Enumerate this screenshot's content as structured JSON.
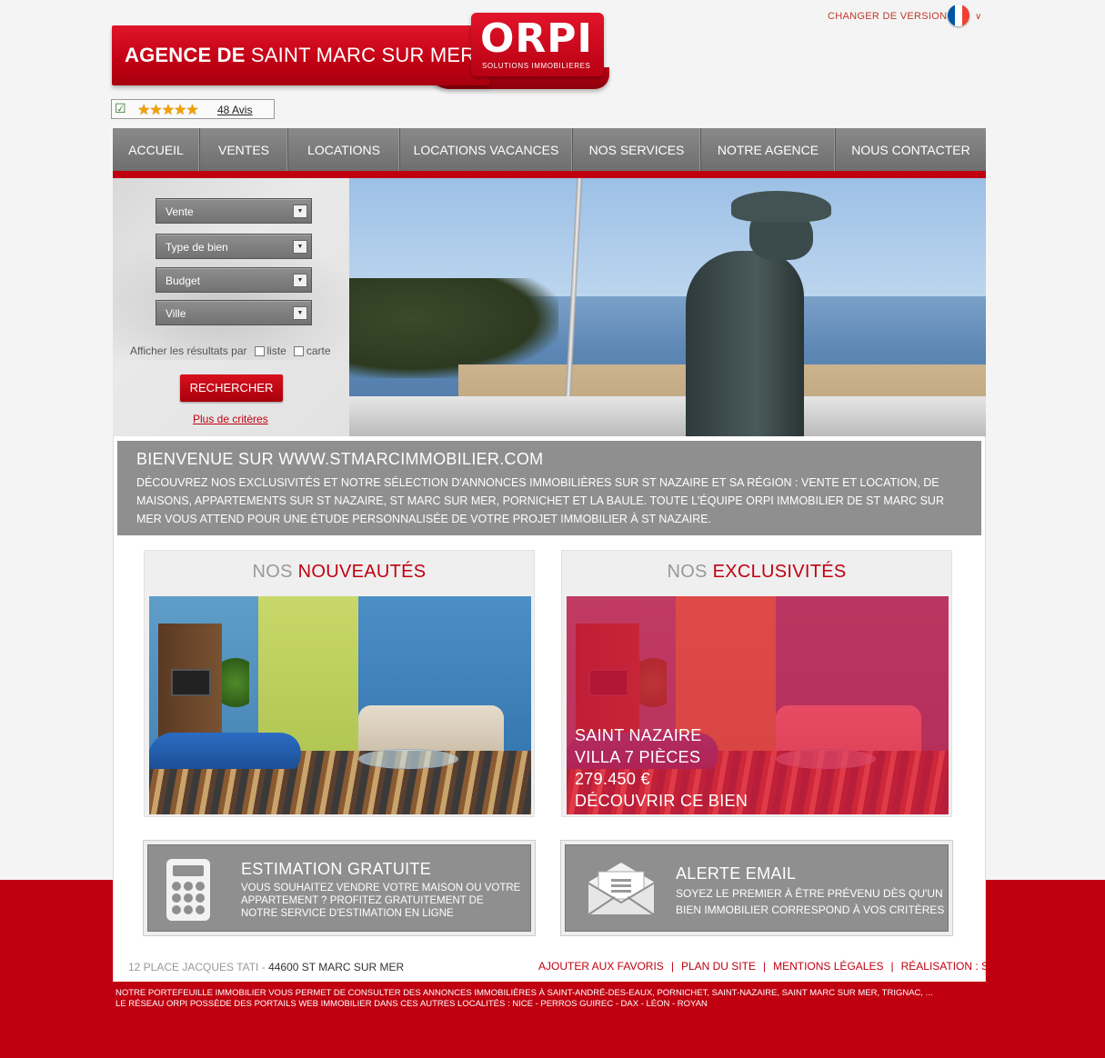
{
  "header": {
    "agency_prefix": "AGENCE DE",
    "agency_city": "SAINT MARC SUR MER",
    "logo_word": "ORPI",
    "logo_sub": "SOLUTIONS IMMOBILIERES",
    "change_version": "CHANGER DE VERSION",
    "flag_colors": [
      "#0055a4",
      "#ffffff",
      "#ef4135"
    ],
    "rating_stars": "★★★★★",
    "rating_value": 4.5,
    "reviews": "48 Avis"
  },
  "nav": {
    "items": [
      "ACCUEIL",
      "VENTES",
      "LOCATIONS",
      "LOCATIONS VACANCES",
      "NOS SERVICES",
      "NOTRE AGENCE",
      "NOUS CONTACTER"
    ]
  },
  "search": {
    "transaction": "Vente",
    "property_type": "Type de bien",
    "budget": "Budget",
    "city": "Ville",
    "display_label": "Afficher les résultats par",
    "list_label": "liste",
    "map_label": "carte",
    "submit": "RECHERCHER",
    "more_criteria": "Plus de critères"
  },
  "welcome": {
    "title": "BIENVENUE SUR WWW.STMARCIMMOBILIER.COM",
    "text": "DÉCOUVREZ NOS EXCLUSIVITÉS ET NOTRE SÉLECTION D'ANNONCES IMMOBILIÈRES SUR ST NAZAIRE ET SA RÉGION : VENTE ET LOCATION, DE MAISONS, APPARTEMENTS SUR ST NAZAIRE, ST MARC SUR MER, PORNICHET ET LA BAULE. TOUTE L'ÉQUIPE ORPI IMMOBILIER DE ST MARC SUR MER VOUS ATTEND POUR UNE ÉTUDE PERSONNALISÉE DE VOTRE PROJET IMMOBILIER À ST NAZAIRE."
  },
  "nouveautes": {
    "prefix": "NOS",
    "highlight": "NOUVEAUTÉS"
  },
  "exclusivites": {
    "prefix": "NOS",
    "highlight": "EXCLUSIVITÉS",
    "city": "SAINT NAZAIRE",
    "type": "VILLA 7 PIÈCES",
    "price": "279.450 €",
    "cta": "DÉCOUVRIR CE BIEN"
  },
  "estimation": {
    "title": "ESTIMATION GRATUITE",
    "text": "VOUS SOUHAITEZ VENDRE VOTRE MAISON OU VOTRE APPARTEMENT ? PROFITEZ GRATUITEMENT DE NOTRE SERVICE D'ESTIMATION EN LIGNE"
  },
  "alerte": {
    "title": "ALERTE EMAIL",
    "text": "SOYEZ LE PREMIER À ÊTRE PRÉVENU DÈS QU'UN BIEN IMMOBILIER CORRESPOND À VOS CRITÈRES"
  },
  "footer": {
    "address": "12 PLACE JACQUES TATI",
    "city": "44600 ST MARC SUR MER",
    "links": [
      "AJOUTER AUX FAVORIS",
      "PLAN DU SITE",
      "MENTIONS LÉGALES",
      "RÉALISATION : SELOGER"
    ],
    "seo_line1": "NOTRE PORTEFEUILLE IMMOBILIER VOUS PERMET DE CONSULTER DES ANNONCES IMMOBILIÈRES À SAINT-ANDRÉ-DES-EAUX, PORNICHET, SAINT-NAZAIRE, SAINT MARC SUR MER, TRIGNAC, ...",
    "seo_line2": "LE RÉSEAU ORPI POSSÈDE DES PORTAILS WEB IMMOBILIER DANS CES AUTRES LOCALITÉS : NICE - PERROS GUIREC - DAX - LÉON - ROYAN"
  },
  "colors": {
    "brand_red": "#c00010",
    "panel_grey": "#8f8f8f"
  }
}
